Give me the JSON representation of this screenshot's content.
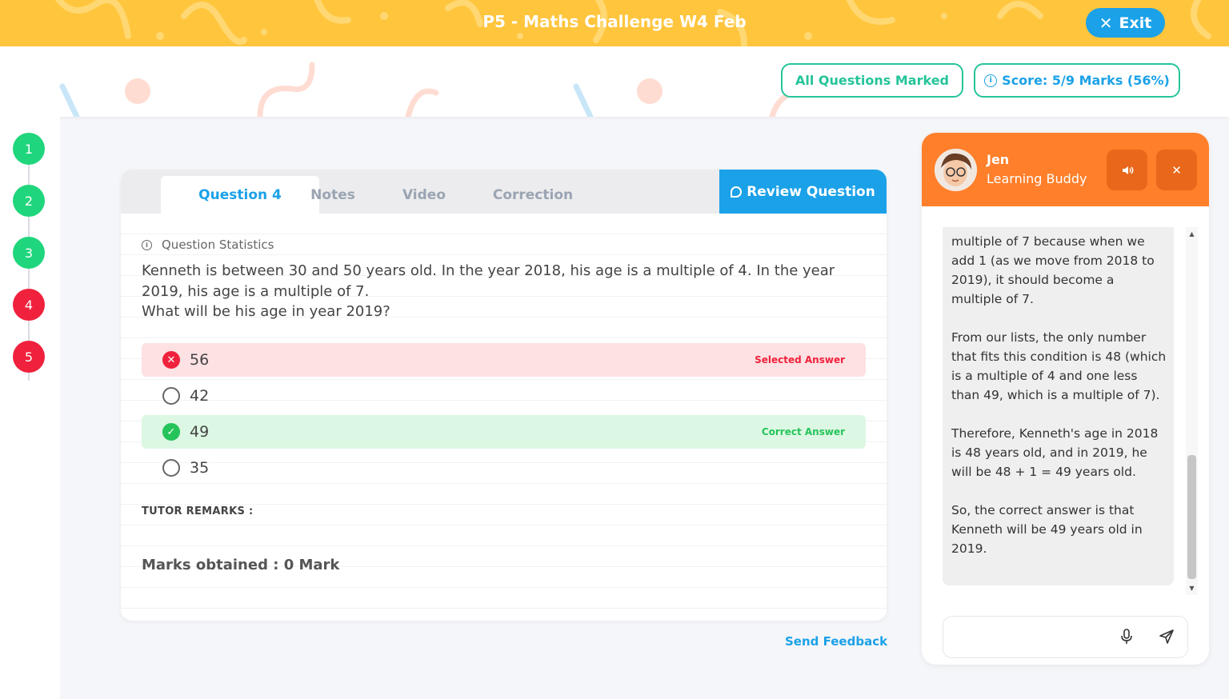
{
  "topbar": {
    "title": "P5 - Maths Challenge W4 Feb",
    "exit_label": "Exit"
  },
  "header": {
    "all_marked_label": "All Questions Marked",
    "score_label": "Score: 5/9 Marks (56%)"
  },
  "rail": {
    "items": [
      {
        "label": "1",
        "status": "correct"
      },
      {
        "label": "2",
        "status": "correct"
      },
      {
        "label": "3",
        "status": "correct"
      },
      {
        "label": "4",
        "status": "wrong"
      },
      {
        "label": "5",
        "status": "wrong"
      }
    ]
  },
  "tabs": [
    {
      "label": "Question 4"
    },
    {
      "label": "Notes"
    },
    {
      "label": "Video"
    },
    {
      "label": "Correction"
    }
  ],
  "review_label": "Review Question",
  "question": {
    "stats_label": "Question Statistics",
    "text_1": "Kenneth is between 30 and 50 years old. In the year 2018, his age is a multiple of 4. In the year 2019, his age is a multiple of 7.",
    "text_2": "What will be his age in year 2019?",
    "options": [
      {
        "value": "56",
        "tag": "Selected Answer"
      },
      {
        "value": "42",
        "tag": ""
      },
      {
        "value": "49",
        "tag": "Correct Answer"
      },
      {
        "value": "35",
        "tag": ""
      }
    ],
    "remarks_label": "TUTOR REMARKS :",
    "marks_label": "Marks obtained : 0 Mark"
  },
  "feedback_label": "Send Feedback",
  "chat": {
    "name": "Jen",
    "role": "Learning Buddy",
    "messages": [
      "multiple of 7 because when we add 1 (as we move from 2018 to 2019), it should become a multiple of 7.",
      "From our lists, the only number that fits this condition is 48 (which is a multiple of 4 and one less than 49, which is a multiple of 7).",
      "Therefore, Kenneth's age in 2018 is 48 years old, and in 2019, he will be 48 + 1 = 49 years old.",
      "So, the correct answer is that Kenneth will be 49 years old in 2019."
    ]
  },
  "colors": {
    "topbar": "#ffc53d",
    "primary": "#1ba1e8",
    "green": "#25c49a",
    "wrong": "#f0213c",
    "correct": "#1fd67c",
    "chat_header": "#ff7f2a"
  },
  "icons": [
    "close-icon",
    "info-icon",
    "chat-bubble-icon",
    "cross-circle-icon",
    "check-circle-icon",
    "speaker-icon",
    "microphone-icon",
    "send-icon"
  ]
}
